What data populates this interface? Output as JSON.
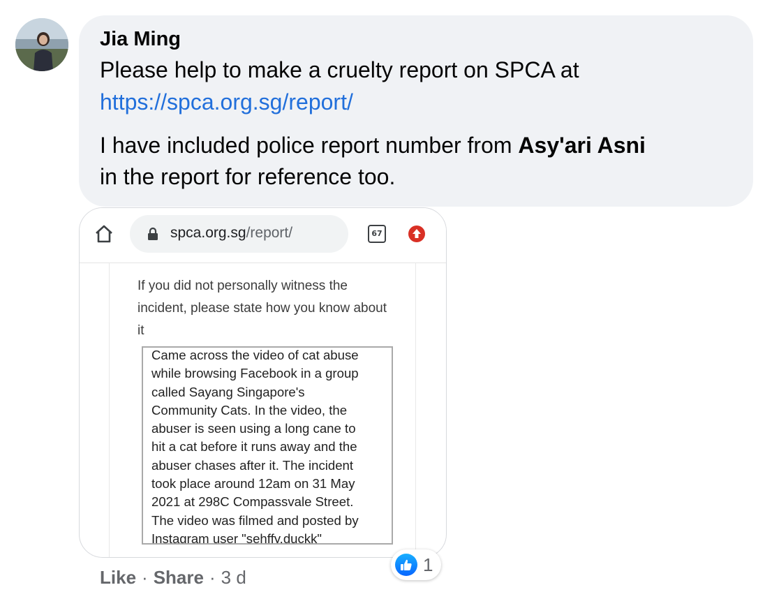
{
  "comment": {
    "author": "Jia Ming",
    "text_line1": "Please help to make a cruelty report on SPCA at",
    "link": "https://spca.org.sg/report/",
    "text_line3_prefix": "I have included police report number from ",
    "mention": "Asy'ari Asni",
    "text_line4": "in the report for reference too."
  },
  "attachment": {
    "browser": {
      "url_domain": "spca.org.sg",
      "url_path": "/report/",
      "tab_count": "67"
    },
    "question": "If you did not personally witness the incident, please state how you know about it",
    "answer": "Came across the video of cat abuse\nwhile browsing Facebook in a group\ncalled Sayang Singapore's\nCommunity Cats. In the video, the\nabuser is seen using a long cane to\nhit a cat before it runs away and the\nabuser chases after it. The incident\ntook place around 12am on 31 May\n2021 at 298C Compassvale Street.\nThe video was filmed and posted by\nInstagram user \"sehffy.duckk\""
  },
  "reactions": {
    "icon": "like-thumb-icon",
    "count": "1"
  },
  "actions": {
    "like": "Like",
    "share": "Share",
    "separator": "·",
    "time": "3 d"
  },
  "colors": {
    "bubble": "#f0f2f5",
    "link": "#216fdb",
    "secondary_text": "#65676b",
    "like_blue": "#0866ff",
    "update_red": "#d93025"
  }
}
